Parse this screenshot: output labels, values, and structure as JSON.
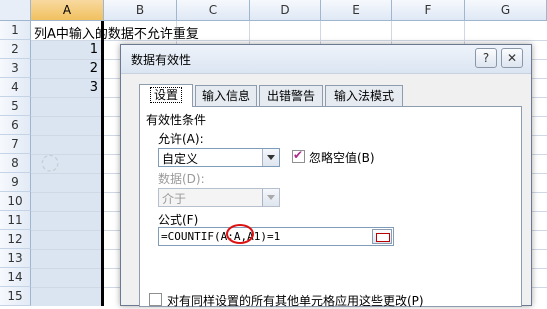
{
  "spreadsheet": {
    "columns": [
      "A",
      "B",
      "C",
      "D",
      "E",
      "F",
      "G"
    ],
    "rows": [
      "1",
      "2",
      "3",
      "4",
      "5",
      "6",
      "7",
      "8",
      "9",
      "10",
      "11",
      "12",
      "13",
      "14",
      "15"
    ],
    "a1_text": "列A中输入的数据不允许重复",
    "values": [
      "1",
      "2",
      "3"
    ]
  },
  "dialog": {
    "title": "数据有效性",
    "help_label": "?",
    "close_label": "✕",
    "tabs": [
      "设置",
      "输入信息",
      "出错警告",
      "输入法模式"
    ],
    "group_label": "有效性条件",
    "allow_label": "允许(A):",
    "allow_value": "自定义",
    "ignore_blank_label": "忽略空值(B)",
    "ignore_blank_checked": true,
    "data_label": "数据(D):",
    "data_value": "介于",
    "formula_label": "公式(F)",
    "formula_value": "=COUNTIF(A:A,A1)=1",
    "apply_all_label": "对有同样设置的所有其他单元格应用这些更改(P)"
  },
  "colors": {
    "accent_red": "#d11111",
    "selection": "#dbe5f1",
    "check_color": "#b02a8c"
  }
}
